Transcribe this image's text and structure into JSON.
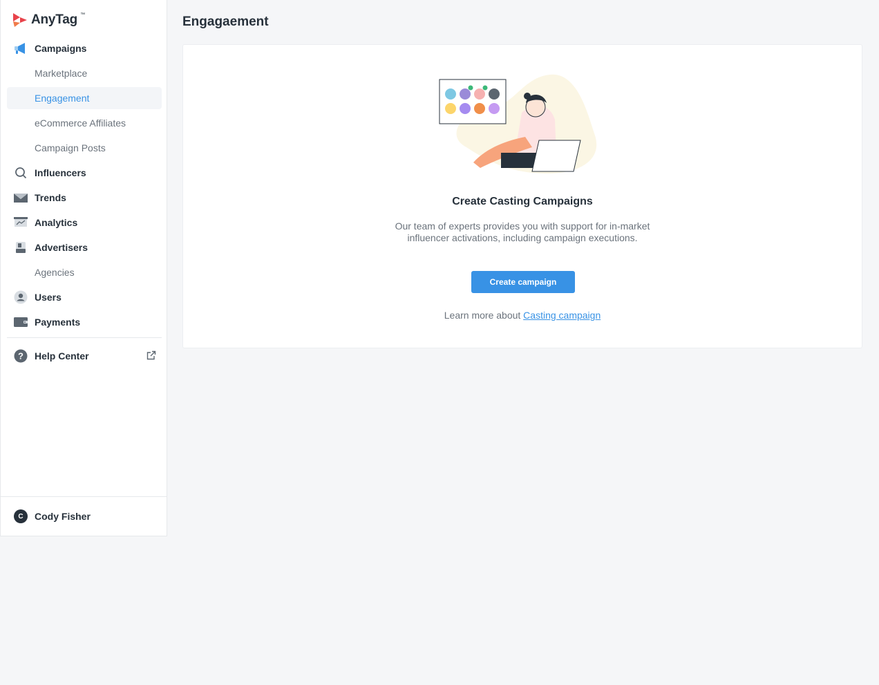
{
  "brand": {
    "name": "AnyTag",
    "tm": "™"
  },
  "sidebar": {
    "items": [
      {
        "label": "Campaigns",
        "icon": "megaphone-icon"
      },
      {
        "label": "Marketplace"
      },
      {
        "label": "Engagement",
        "active": true
      },
      {
        "label": "eCommerce Affiliates"
      },
      {
        "label": "Campaign Posts"
      },
      {
        "label": "Influencers",
        "icon": "search-icon"
      },
      {
        "label": "Trends",
        "icon": "trends-icon"
      },
      {
        "label": "Analytics",
        "icon": "analytics-icon"
      },
      {
        "label": "Advertisers",
        "icon": "advertiser-icon"
      },
      {
        "label": "Agencies"
      },
      {
        "label": "Users",
        "icon": "user-icon"
      },
      {
        "label": "Payments",
        "icon": "wallet-icon"
      }
    ],
    "help": {
      "label": "Help Center",
      "icon": "help-icon",
      "external_icon": "external-link-icon"
    },
    "user": {
      "initial": "C",
      "name": "Cody Fisher"
    }
  },
  "page": {
    "title": "Engagaement"
  },
  "empty_state": {
    "title": "Create Casting Campaigns",
    "desc_line1": "Our team of experts provides you with support for in-market",
    "desc_line2": "influencer activations, including campaign executions.",
    "button": "Create campaign",
    "learn_prefix": "Learn more about ",
    "learn_link": "Casting campaign"
  },
  "colors": {
    "accent": "#3892e5",
    "text": "#27313b",
    "muted": "#6b737c",
    "bg": "#f5f6f8"
  }
}
